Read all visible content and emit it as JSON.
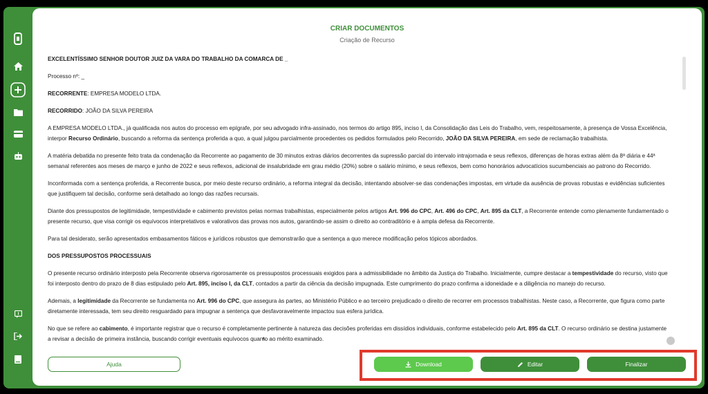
{
  "sidebar": {
    "icons": [
      "phone-icon",
      "home-icon",
      "plus-icon",
      "folder-icon",
      "card-icon",
      "robot-icon",
      "chat-icon",
      "logout-icon",
      "book-icon"
    ]
  },
  "header": {
    "title": "CRIAR DOCUMENTOS",
    "subtitle": "Criação de Recurso"
  },
  "document": {
    "salutation": "EXCELENTÍSSIMO SENHOR DOUTOR JUIZ DA VARA DO TRABALHO DA COMARCA DE _",
    "process": "Processo nº: _",
    "appellant_label": "RECORRENTE",
    "appellant_value": ": EMPRESA MODELO LTDA.",
    "appellee_label": "RECORRIDO",
    "appellee_value": ": JOÃO DA SILVA PEREIRA",
    "p1a": "A EMPRESA MODELO LTDA., já qualificada nos autos do processo em epígrafe, por seu advogado infra-assinado, nos termos do artigo 895, inciso I, da Consolidação das Leis do Trabalho, vem, respeitosamente, à presença de Vossa Excelência, interpor ",
    "p1b": "Recurso Ordinário",
    "p1c": ", buscando a reforma da sentença proferida a quo, a qual julgou parcialmente procedentes os pedidos formulados pelo Recorrido, ",
    "p1d": "JOÃO DA SILVA PEREIRA",
    "p1e": ", em sede de reclamação trabalhista.",
    "p2": "A matéria debatida no presente feito trata da condenação da Recorrente ao pagamento de 30 minutos extras diários decorrentes da supressão parcial do intervalo intrajornada e seus reflexos, diferenças de horas extras além da 8ª diária e 44ª semanal referentes aos meses de março e junho de 2022 e seus reflexos, adicional de insalubridade em grau médio (20%) sobre o salário mínimo, e seus reflexos, bem como honorários advocatícios sucumbenciais ao patrono do Recorrido.",
    "p3": "Inconformada com a sentença proferida, a Recorrente busca, por meio deste recurso ordinário, a reforma integral da decisão, intentando absolver-se das condenações impostas, em virtude da ausência de provas robustas e evidências suficientes que justifiquem tal decisão, conforme será detalhado ao longo das razões recursais.",
    "p4a": "Diante dos pressupostos de legitimidade, tempestividade e cabimento previstos pelas normas trabalhistas, especialmente pelos artigos ",
    "p4b": "Art. 996 do CPC",
    "p4c": ", ",
    "p4d": "Art. 496 do CPC",
    "p4e": ", ",
    "p4f": "Art. 895 da CLT",
    "p4g": ", a Recorrente entende como plenamente fundamentado o presente recurso, que visa corrigir os equívocos interpretativos e valorativos das provas nos autos, garantindo-se assim o direito ao contraditório e à ampla defesa da Recorrente.",
    "p5": "Para tal desiderato, serão apresentados embasamentos fáticos e jurídicos robustos que demonstrarão que a sentença a quo merece modificação pelos tópicos abordados.",
    "section": "DOS PRESSUPOSTOS PROCESSUAIS",
    "p6a": "O presente recurso ordinário interposto pela Recorrente observa rigorosamente os pressupostos processuais exigidos para a admissibilidade no âmbito da Justiça do Trabalho. Inicialmente, cumpre destacar a ",
    "p6b": "tempestividade",
    "p6c": " do recurso, visto que foi interposto dentro do prazo de 8 dias estipulado pelo ",
    "p6d": "Art. 895, inciso I, da CLT",
    "p6e": ", contados a partir da ciência da decisão impugnada. Este cumprimento do prazo confirma a idoneidade e a diligência no manejo do recurso.",
    "p7a": "Ademais, a ",
    "p7b": "legitimidade",
    "p7c": " da Recorrente se fundamenta no ",
    "p7d": "Art. 996 do CPC",
    "p7e": ", que assegura às partes, ao Ministério Público e ao terceiro prejudicado o direito de recorrer em processos trabalhistas. Neste caso, a Recorrente, que figura como parte diretamente interessada, tem seu direito resguardado para impugnar a sentença que desfavoravelmente impactou sua esfera jurídica.",
    "p8a": "No que se refere ao ",
    "p8b": "cabimento",
    "p8c": ", é importante registrar que o recurso é completamente pertinente à natureza das decisões proferidas em dissídios individuais, conforme estabelecido pelo ",
    "p8d": "Art. 895 da CLT",
    "p8e": ". O recurso ordinário se destina justamente a revisar a decisão de primeira instância, buscando corrigir eventuais equívocos quanto ao mérito examinado."
  },
  "actions": {
    "help": "Ajuda",
    "download": "Download",
    "edit": "Editar",
    "finish": "Finalizar"
  },
  "colors": {
    "brand_green": "#3f8f3a",
    "download_green": "#5dc94d",
    "highlight_red": "#e03a2c"
  }
}
